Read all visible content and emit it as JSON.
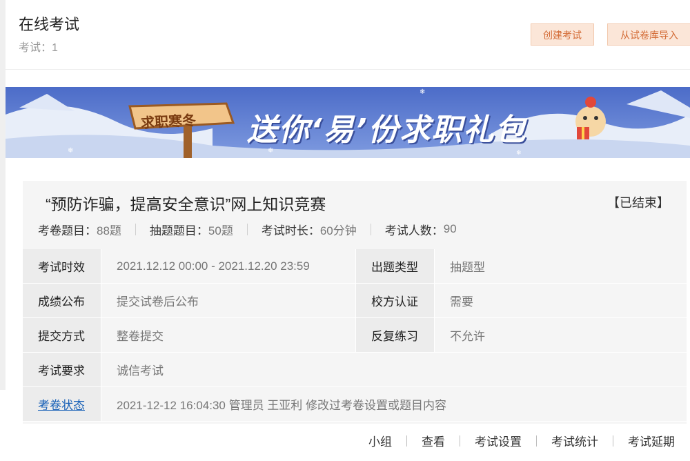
{
  "header": {
    "title": "在线考试",
    "exam_count": "考试：1",
    "create_button": "创建考试",
    "import_button": "从试卷库导入"
  },
  "banner": {
    "sign_text": "求职寒冬",
    "slogan": "送你‘易’份求职礼包"
  },
  "exam": {
    "title": "“预防诈骗，提高安全意识”网上知识竞赛",
    "status": "【已结束】",
    "stats": [
      {
        "label": "考卷题目：",
        "value": "88题"
      },
      {
        "label": "抽题题目：",
        "value": "50题"
      },
      {
        "label": "考试时长：",
        "value": "60分钟"
      },
      {
        "label": "考试人数：",
        "value": "90"
      }
    ],
    "rows": {
      "validity_label": "考试时效",
      "validity_value": "2021.12.12 00:00 - 2021.12.20 23:59",
      "qtype_label": "出题类型",
      "qtype_value": "抽题型",
      "score_label": "成绩公布",
      "score_value": "提交试卷后公布",
      "campus_label": "校方认证",
      "campus_value": "需要",
      "submit_label": "提交方式",
      "submit_value": "整卷提交",
      "repeat_label": "反复练习",
      "repeat_value": "不允许",
      "require_label": "考试要求",
      "require_value": "诚信考试",
      "paper_status_label": "考卷状态",
      "paper_status_value": "2021-12-12 16:04:30 管理员 王亚利 修改过考卷设置或题目内容"
    }
  },
  "footer": {
    "links": [
      "小组",
      "查看",
      "考试设置",
      "考试统计",
      "考试延期"
    ]
  }
}
